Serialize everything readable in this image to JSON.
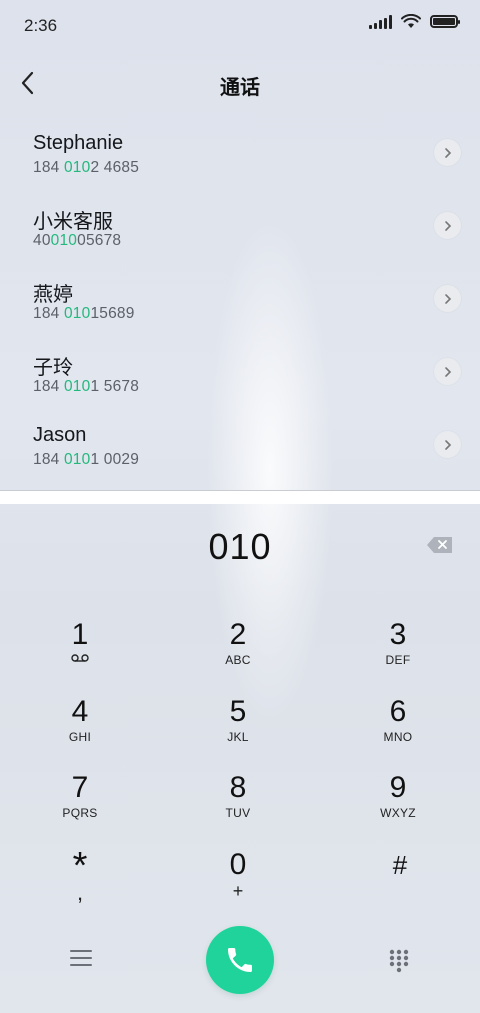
{
  "status_bar": {
    "time": "2:36",
    "battery_level": 1.0
  },
  "header": {
    "title": "通话"
  },
  "contacts": [
    {
      "name": "Stephanie",
      "number_pre": "184 ",
      "number_match": "010",
      "number_post": "2 4685"
    },
    {
      "name": "小米客服",
      "number_pre": "40",
      "number_match": "010",
      "number_post": "05678"
    },
    {
      "name": "燕婷",
      "number_pre": "184 ",
      "number_match": "010",
      "number_post": "15689"
    },
    {
      "name": "子玲",
      "number_pre": "184 ",
      "number_match": "010",
      "number_post": "1 5678"
    },
    {
      "name": "Jason",
      "number_pre": "184 ",
      "number_match": "010",
      "number_post": "1 0029"
    }
  ],
  "dialer": {
    "input": "010"
  },
  "keypad": [
    {
      "digit": "1",
      "letters": ""
    },
    {
      "digit": "2",
      "letters": "ABC"
    },
    {
      "digit": "3",
      "letters": "DEF"
    },
    {
      "digit": "4",
      "letters": "GHI"
    },
    {
      "digit": "5",
      "letters": "JKL"
    },
    {
      "digit": "6",
      "letters": "MNO"
    },
    {
      "digit": "7",
      "letters": "PQRS"
    },
    {
      "digit": "8",
      "letters": "TUV"
    },
    {
      "digit": "9",
      "letters": "WXYZ"
    },
    {
      "digit": "*",
      "letters": ","
    },
    {
      "digit": "0",
      "letters": "+"
    },
    {
      "digit": "#",
      "letters": ""
    }
  ],
  "icons": {
    "back": "chevron-left-icon",
    "detail": "chevron-right-icon",
    "backspace": "backspace-icon",
    "voicemail": "voicemail-icon",
    "menu": "menu-icon",
    "call": "phone-icon",
    "dialpad": "dialpad-icon"
  },
  "colors": {
    "match_highlight": "#25b87d",
    "call_button": "#1fd39a"
  }
}
